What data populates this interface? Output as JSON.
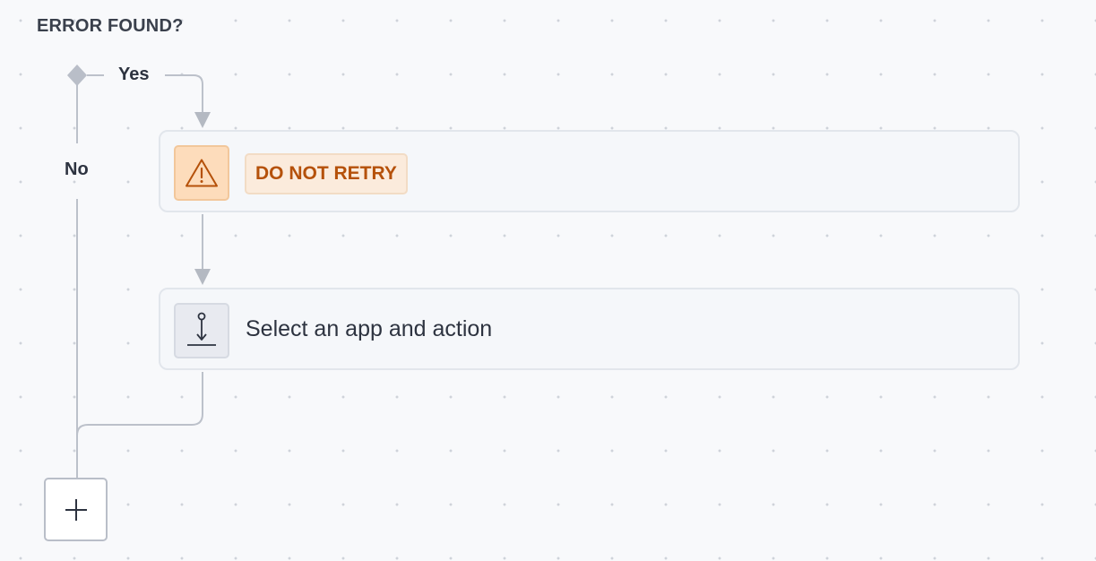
{
  "condition": {
    "title": "ERROR FOUND?",
    "yes_label": "Yes",
    "no_label": "No"
  },
  "steps": [
    {
      "icon": "warning-triangle-icon",
      "label": "DO NOT RETRY",
      "accent_color": "#b5510a"
    },
    {
      "icon": "empty-action-icon",
      "label": "Select an app and action"
    }
  ],
  "add_button": {
    "icon": "plus-icon"
  },
  "colors": {
    "connector": "#bcc1ca",
    "warning_bg": "#fddcbb",
    "warning_text": "#b5510a"
  }
}
